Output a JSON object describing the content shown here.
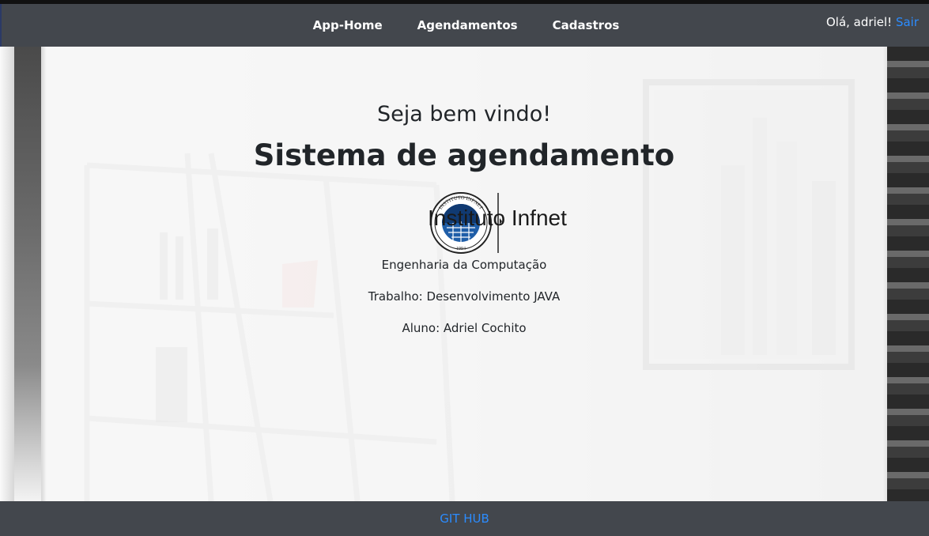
{
  "navbar": {
    "links": [
      {
        "label": "App-Home"
      },
      {
        "label": "Agendamentos"
      },
      {
        "label": "Cadastros"
      }
    ],
    "greeting": "Olá, adriel!",
    "logout_label": "Sair"
  },
  "main": {
    "welcome": "Seja bem vindo!",
    "title": "Sistema de agendamento",
    "logo": {
      "name": "Instituto Infnet",
      "seal_text": "INSTITUTO INFNET",
      "seal_year": "1994"
    },
    "lines": [
      "Engenharia da Computação",
      "Trabalho: Desenvolvimento JAVA",
      "Aluno: Adriel Cochito"
    ]
  },
  "footer": {
    "link_label": "GIT HUB"
  },
  "colors": {
    "navbar_bg": "#43474d",
    "link_accent": "#2b8cff",
    "logo_blue": "#1f5ea8"
  }
}
